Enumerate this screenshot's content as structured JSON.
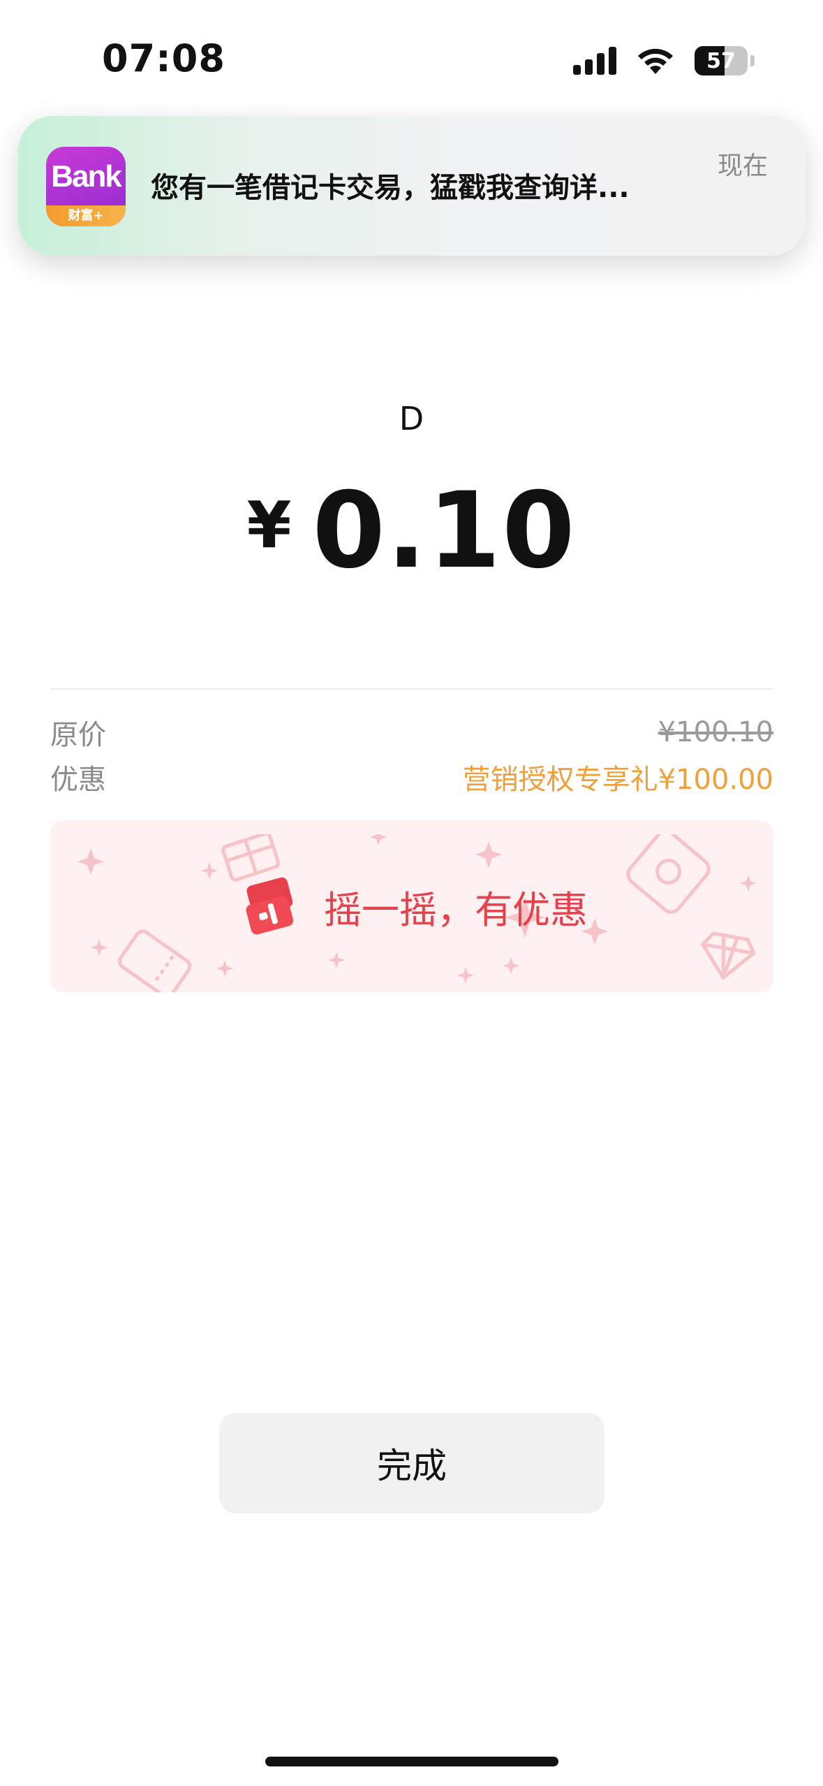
{
  "status_bar": {
    "time": "07:08",
    "battery": "57",
    "battery_level": 0.57
  },
  "notification": {
    "app_icon_brand": "Bank",
    "app_icon_label": "财富+",
    "message": "您有一笔借记卡交易，猛戳我查询详...",
    "time": "现在"
  },
  "payment": {
    "merchant": "D",
    "currency_symbol": "¥",
    "amount": "0.10"
  },
  "details": {
    "original_price_label": "原价",
    "original_price_value": "¥100.10",
    "discount_label": "优惠",
    "discount_value": "营销授权专享礼¥100.00"
  },
  "promo_banner": {
    "text": "摇一摇，有优惠"
  },
  "actions": {
    "done_label": "完成"
  },
  "colors": {
    "accent_orange": "#f0a03a",
    "promo_red": "#e6414b",
    "promo_bg": "#fff1f2"
  },
  "icons": [
    "signal-icon",
    "wifi-icon",
    "battery-icon",
    "bank-app-icon",
    "shake-coupon-icon",
    "gift-icon",
    "diamond-icon",
    "ticket-icon",
    "sparkle-icon"
  ]
}
